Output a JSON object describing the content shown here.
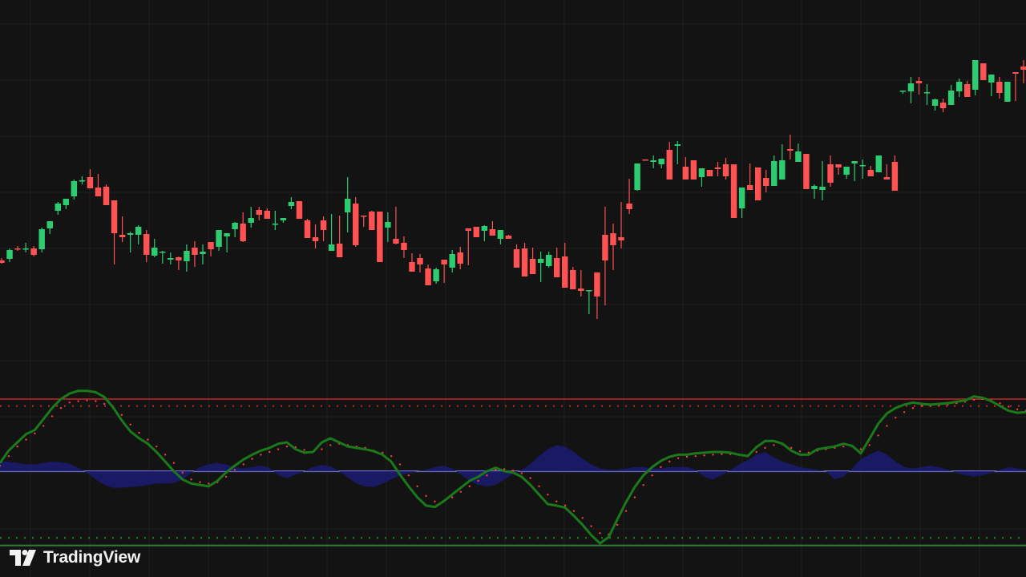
{
  "brand": {
    "name": "TradingView",
    "logo_icon": "tradingview-logo-icon"
  },
  "colors": {
    "background": "#131313",
    "grid": "#1f1f1f",
    "up": "#2ecc71",
    "down": "#ff5252",
    "oscillator": "#1a7a1a",
    "signal_dots": "#ff3b3b",
    "histogram": "#1b1b6e",
    "upper_band": "#c62828",
    "lower_band": "#2e7d32",
    "zero_line": "#8c8cff"
  },
  "chart_data": [
    {
      "type": "candlestick",
      "title": "",
      "xlabel": "",
      "ylabel": "",
      "grid": true,
      "ylim": [
        0,
        460
      ],
      "candles": [
        [
          145,
          148,
          141,
          142
        ],
        [
          147,
          160,
          143,
          158
        ],
        [
          160,
          163,
          157,
          159
        ],
        [
          159,
          167,
          155,
          160
        ],
        [
          160,
          163,
          150,
          152
        ],
        [
          159,
          186,
          155,
          184
        ],
        [
          185,
          194,
          178,
          194
        ],
        [
          207,
          218,
          202,
          216
        ],
        [
          214,
          221,
          209,
          222
        ],
        [
          225,
          246,
          221,
          244
        ],
        [
          244,
          250,
          240,
          245
        ],
        [
          249,
          259,
          236,
          235
        ],
        [
          236,
          253,
          225,
          225
        ],
        [
          237,
          240,
          217,
          214
        ],
        [
          220,
          212,
          140,
          179
        ],
        [
          177,
          200,
          168,
          174
        ],
        [
          177,
          181,
          155,
          179
        ],
        [
          177,
          189,
          165,
          187
        ],
        [
          178,
          183,
          143,
          152
        ],
        [
          151,
          172,
          149,
          161
        ],
        [
          155,
          157,
          141,
          156
        ],
        [
          146,
          155,
          140,
          148
        ],
        [
          149,
          150,
          133,
          145
        ],
        [
          144,
          165,
          131,
          157
        ],
        [
          161,
          169,
          137,
          152
        ],
        [
          153,
          165,
          140,
          156
        ],
        [
          168,
          163,
          150,
          159
        ],
        [
          162,
          181,
          157,
          183
        ],
        [
          175,
          179,
          155,
          179
        ],
        [
          184,
          193,
          174,
          192
        ],
        [
          191,
          205,
          168,
          169
        ],
        [
          192,
          212,
          186,
          198
        ],
        [
          208,
          212,
          195,
          202
        ],
        [
          207,
          210,
          198,
          197
        ],
        [
          191,
          207,
          183,
          191
        ],
        [
          195,
          198,
          192,
          198
        ],
        [
          213,
          224,
          209,
          218
        ],
        [
          219,
          218,
          198,
          197
        ],
        [
          195,
          197,
          178,
          173
        ],
        [
          174,
          190,
          160,
          169
        ],
        [
          195,
          200,
          169,
          183
        ],
        [
          157,
          203,
          161,
          165
        ],
        [
          166,
          201,
          158,
          149
        ],
        [
          205,
          249,
          180,
          222
        ],
        [
          216,
          224,
          162,
          164
        ],
        [
          201,
          198,
          187,
          200
        ],
        [
          206,
          207,
          190,
          183
        ],
        [
          206,
          204,
          162,
          143
        ],
        [
          186,
          205,
          168,
          193
        ],
        [
          172,
          212,
          165,
          166
        ],
        [
          167,
          175,
          148,
          158
        ],
        [
          143,
          154,
          133,
          131
        ],
        [
          148,
          153,
          130,
          140
        ],
        [
          135,
          140,
          114,
          114
        ],
        [
          119,
          136,
          116,
          134
        ],
        [
          146,
          146,
          117,
          140
        ],
        [
          136,
          158,
          130,
          153
        ],
        [
          155,
          162,
          134,
          141
        ],
        [
          185,
          184,
          139,
          182
        ],
        [
          187,
          186,
          174,
          174
        ],
        [
          182,
          189,
          169,
          188
        ],
        [
          184,
          194,
          178,
          176
        ],
        [
          172,
          181,
          165,
          183
        ],
        [
          176,
          177,
          175,
          172
        ],
        [
          159,
          165,
          145,
          136
        ],
        [
          160,
          167,
          150,
          125
        ],
        [
          147,
          161,
          137,
          128
        ],
        [
          142,
          156,
          118,
          147
        ],
        [
          138,
          156,
          136,
          152
        ],
        [
          148,
          161,
          133,
          124
        ],
        [
          150,
          167,
          124,
          111
        ],
        [
          133,
          137,
          110,
          109
        ],
        [
          110,
          133,
          100,
          107
        ],
        [
          108,
          86,
          78,
          108
        ],
        [
          130,
          97,
          72,
          100
        ],
        [
          177,
          212,
          89,
          145
        ],
        [
          179,
          191,
          133,
          164
        ],
        [
          174,
          218,
          160,
          170
        ],
        [
          216,
          247,
          203,
          209
        ],
        [
          233,
          265,
          232,
          266
        ],
        [
          271,
          269,
          271,
          270
        ],
        [
          268,
          276,
          260,
          270
        ],
        [
          265,
          272,
          260,
          272
        ],
        [
          283,
          293,
          263,
          246
        ],
        [
          288,
          294,
          265,
          290
        ],
        [
          262,
          274,
          264,
          246
        ],
        [
          270,
          268,
          247,
          246
        ],
        [
          249,
          249,
          237,
          260
        ],
        [
          258,
          258,
          265,
          250
        ],
        [
          261,
          268,
          250,
          259
        ],
        [
          265,
          273,
          246,
          250
        ],
        [
          265,
          260,
          220,
          198
        ],
        [
          210,
          229,
          198,
          236
        ],
        [
          239,
          266,
          235,
          233
        ],
        [
          261,
          255,
          231,
          220
        ],
        [
          248,
          258,
          230,
          238
        ],
        [
          238,
          276,
          245,
          269
        ],
        [
          246,
          290,
          246,
          270
        ],
        [
          284,
          302,
          271,
          282
        ],
        [
          268,
          291,
          270,
          281
        ],
        [
          278,
          269,
          275,
          234
        ],
        [
          234,
          240,
          222,
          238
        ],
        [
          233,
          269,
          220,
          237
        ],
        [
          265,
          276,
          237,
          242
        ],
        [
          265,
          259,
          252,
          261
        ],
        [
          252,
          255,
          247,
          262
        ],
        [
          266,
          269,
          244,
          269
        ],
        [
          264,
          271,
          247,
          264
        ],
        [
          258,
          263,
          251,
          250
        ],
        [
          255,
          259,
          260,
          276
        ],
        [
          249,
          265,
          255,
          246
        ],
        [
          268,
          276,
          260,
          232
        ],
        [
          357,
          357,
          353,
          357
        ],
        [
          356,
          374,
          341,
          366
        ],
        [
          369,
          374,
          352,
          366
        ],
        [
          355,
          365,
          339,
          355
        ],
        [
          338,
          347,
          332,
          346
        ],
        [
          342,
          347,
          330,
          335
        ],
        [
          339,
          364,
          343,
          357
        ],
        [
          356,
          372,
          349,
          368
        ],
        [
          365,
          369,
          358,
          349
        ],
        [
          358,
          381,
          351,
          395
        ],
        [
          391,
          385,
          386,
          370
        ],
        [
          367,
          375,
          350,
          377
        ],
        [
          368,
          374,
          347,
          354
        ],
        [
          343,
          367,
          345,
          368
        ],
        [
          380,
          378,
          344,
          378
        ],
        [
          387,
          395,
          366,
          383
        ]
      ]
    },
    {
      "type": "line",
      "title": "",
      "xlabel": "",
      "ylabel": "",
      "grid": true,
      "ylim": [
        -140,
        140
      ],
      "reference_lines": {
        "upper": 105,
        "upper_dotted": 95,
        "zero": 0,
        "lower_dotted": -97,
        "lower": -108
      },
      "series": [
        {
          "kind": "oscillator_line",
          "values": [
            12,
            30,
            42,
            54,
            60,
            76,
            92,
            105,
            113,
            117,
            117,
            115,
            108,
            93,
            74,
            58,
            48,
            40,
            28,
            14,
            0,
            -12,
            -18,
            -20,
            -22,
            -14,
            -2,
            8,
            17,
            24,
            30,
            34,
            40,
            42,
            32,
            27,
            28,
            42,
            48,
            42,
            36,
            34,
            32,
            29,
            24,
            14,
            -5,
            -22,
            -38,
            -50,
            -52,
            -44,
            -34,
            -24,
            -14,
            -8,
            0,
            5,
            0,
            -2,
            -8,
            -20,
            -34,
            -48,
            -50,
            -53,
            -65,
            -78,
            -93,
            -105,
            -96,
            -70,
            -45,
            -23,
            -6,
            6,
            15,
            21,
            24,
            24,
            26,
            27,
            28,
            28,
            27,
            24,
            22,
            35,
            44,
            44,
            40,
            30,
            24,
            24,
            32,
            34,
            36,
            40,
            37,
            26,
            47,
            69,
            84,
            92,
            97,
            100,
            98,
            97,
            98,
            99,
            101,
            103,
            109,
            107,
            102,
            95,
            88,
            85,
            86
          ]
        },
        {
          "kind": "signal_dots",
          "values": [
            8,
            22,
            36,
            46,
            55,
            66,
            80,
            92,
            100,
            102,
            103,
            102,
            98,
            92,
            82,
            68,
            56,
            46,
            36,
            24,
            12,
            -2,
            -12,
            -16,
            -18,
            -16,
            -8,
            2,
            10,
            18,
            24,
            28,
            32,
            36,
            35,
            31,
            28,
            32,
            38,
            40,
            38,
            36,
            34,
            30,
            27,
            22,
            10,
            -6,
            -22,
            -36,
            -44,
            -44,
            -38,
            -30,
            -22,
            -14,
            -6,
            2,
            3,
            1,
            -3,
            -10,
            -22,
            -34,
            -44,
            -50,
            -58,
            -68,
            -80,
            -90,
            -92,
            -78,
            -58,
            -38,
            -20,
            -6,
            6,
            14,
            19,
            21,
            22,
            23,
            24,
            25,
            25,
            24,
            23,
            28,
            34,
            38,
            39,
            34,
            29,
            27,
            30,
            32,
            34,
            36,
            36,
            32,
            38,
            52,
            66,
            78,
            86,
            92,
            95,
            95,
            96,
            97,
            99,
            101,
            104,
            105,
            103,
            99,
            94,
            90,
            88
          ]
        },
        {
          "kind": "histogram",
          "values": [
            14,
            14,
            12,
            10,
            10,
            12,
            14,
            13,
            11,
            5,
            -2,
            -12,
            -20,
            -24,
            -24,
            -23,
            -22,
            -20,
            -18,
            -18,
            -17,
            -12,
            -2,
            6,
            10,
            12,
            10,
            6,
            4,
            6,
            8,
            5,
            -6,
            -10,
            -5,
            0,
            6,
            9,
            7,
            0,
            -9,
            -18,
            -22,
            -23,
            -18,
            -12,
            -6,
            -3,
            0,
            2,
            6,
            8,
            4,
            -5,
            -14,
            -20,
            -22,
            -20,
            -12,
            -4,
            2,
            10,
            22,
            32,
            38,
            36,
            28,
            18,
            10,
            4,
            2,
            2,
            4,
            6,
            6,
            4,
            4,
            6,
            6,
            6,
            2,
            -8,
            -12,
            -6,
            2,
            10,
            16,
            24,
            28,
            20,
            14,
            10,
            6,
            4,
            2,
            0,
            -12,
            -8,
            4,
            18,
            24,
            30,
            24,
            14,
            6,
            4,
            6,
            8,
            6,
            2,
            -2,
            -6,
            -8,
            -6,
            -2,
            2,
            6,
            4,
            2
          ]
        }
      ]
    }
  ]
}
